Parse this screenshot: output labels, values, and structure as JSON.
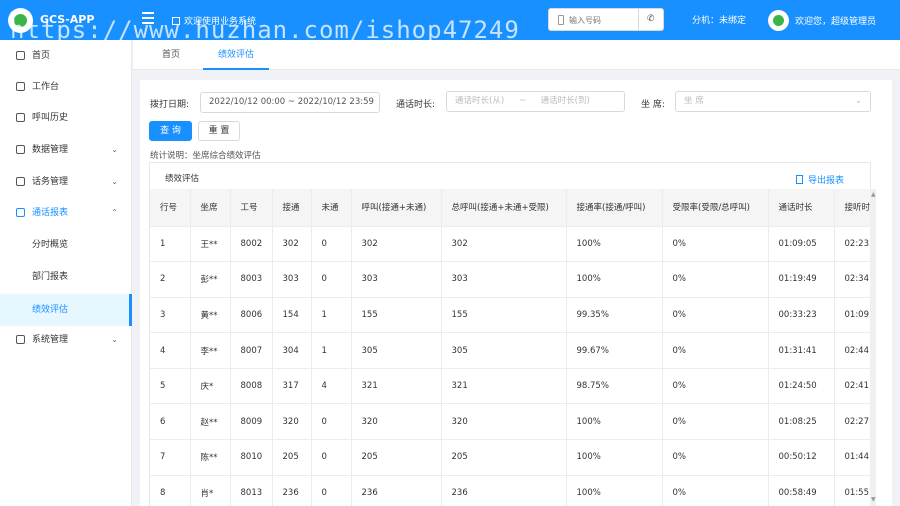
{
  "app": {
    "name": "GCS-APP",
    "welcome_system": "欢迎使用业务系统",
    "phone_placeholder": "输入号码",
    "call_icon": "phone-icon",
    "extension_status": "分机：未绑定",
    "user_greeting": "欢迎您，超级管理员",
    "brand_color": "#1890ff"
  },
  "watermark": "https://www.huzhan.com/ishop47249",
  "sidebar": {
    "items": [
      {
        "label": "首页",
        "icon": "home-icon"
      },
      {
        "label": "工作台",
        "icon": "headset-icon"
      },
      {
        "label": "呼叫历史",
        "icon": "history-icon"
      },
      {
        "label": "数据管理",
        "icon": "data-icon"
      },
      {
        "label": "话务管理",
        "icon": "phone-icon"
      },
      {
        "label": "通话报表",
        "icon": "chart-icon"
      },
      {
        "label": "系统管理",
        "icon": "gear-icon"
      }
    ],
    "sub_items": [
      {
        "label": "分时概览"
      },
      {
        "label": "部门报表"
      },
      {
        "label": "绩效评估"
      }
    ]
  },
  "tabs": [
    {
      "label": "首页"
    },
    {
      "label": "绩效评估"
    }
  ],
  "filters": {
    "dial_date_label": "拨打日期:",
    "dial_date_value": "2022/10/12 00:00 ~ 2022/10/12 23:59",
    "duration_label": "通话时长:",
    "duration_from_placeholder": "通话时长(从)",
    "duration_sep": "~",
    "duration_to_placeholder": "通话时长(到)",
    "seat_label": "坐 席:",
    "seat_placeholder": "坐 席",
    "query_button": "查 询",
    "reset_button": "重 置"
  },
  "stat_note": "统计说明：坐席综合绩效评估",
  "panel": {
    "title": "绩效评估",
    "export_label": "导出报表"
  },
  "table": {
    "columns": [
      "行号",
      "坐席",
      "工号",
      "接通",
      "未通",
      "呼叫(接通+未通)",
      "总呼叫(接通+未通+受限)",
      "接通率(接通/呼叫)",
      "受限率(受限/总呼叫)",
      "通话时长",
      "接听时"
    ],
    "rows": [
      [
        "1",
        "王**",
        "8002",
        "302",
        "0",
        "302",
        "302",
        "100%",
        "0%",
        "01:09:05",
        "02:23"
      ],
      [
        "2",
        "彭**",
        "8003",
        "303",
        "0",
        "303",
        "303",
        "100%",
        "0%",
        "01:19:49",
        "02:34"
      ],
      [
        "3",
        "黄**",
        "8006",
        "154",
        "1",
        "155",
        "155",
        "99.35%",
        "0%",
        "00:33:23",
        "01:09"
      ],
      [
        "4",
        "李**",
        "8007",
        "304",
        "1",
        "305",
        "305",
        "99.67%",
        "0%",
        "01:31:41",
        "02:44"
      ],
      [
        "5",
        "庆*",
        "8008",
        "317",
        "4",
        "321",
        "321",
        "98.75%",
        "0%",
        "01:24:50",
        "02:41"
      ],
      [
        "6",
        "赵**",
        "8009",
        "320",
        "0",
        "320",
        "320",
        "100%",
        "0%",
        "01:08:25",
        "02:27"
      ],
      [
        "7",
        "陈**",
        "8010",
        "205",
        "0",
        "205",
        "205",
        "100%",
        "0%",
        "00:50:12",
        "01:44"
      ],
      [
        "8",
        "肖*",
        "8013",
        "236",
        "0",
        "236",
        "236",
        "100%",
        "0%",
        "00:58:49",
        "01:55"
      ]
    ]
  }
}
